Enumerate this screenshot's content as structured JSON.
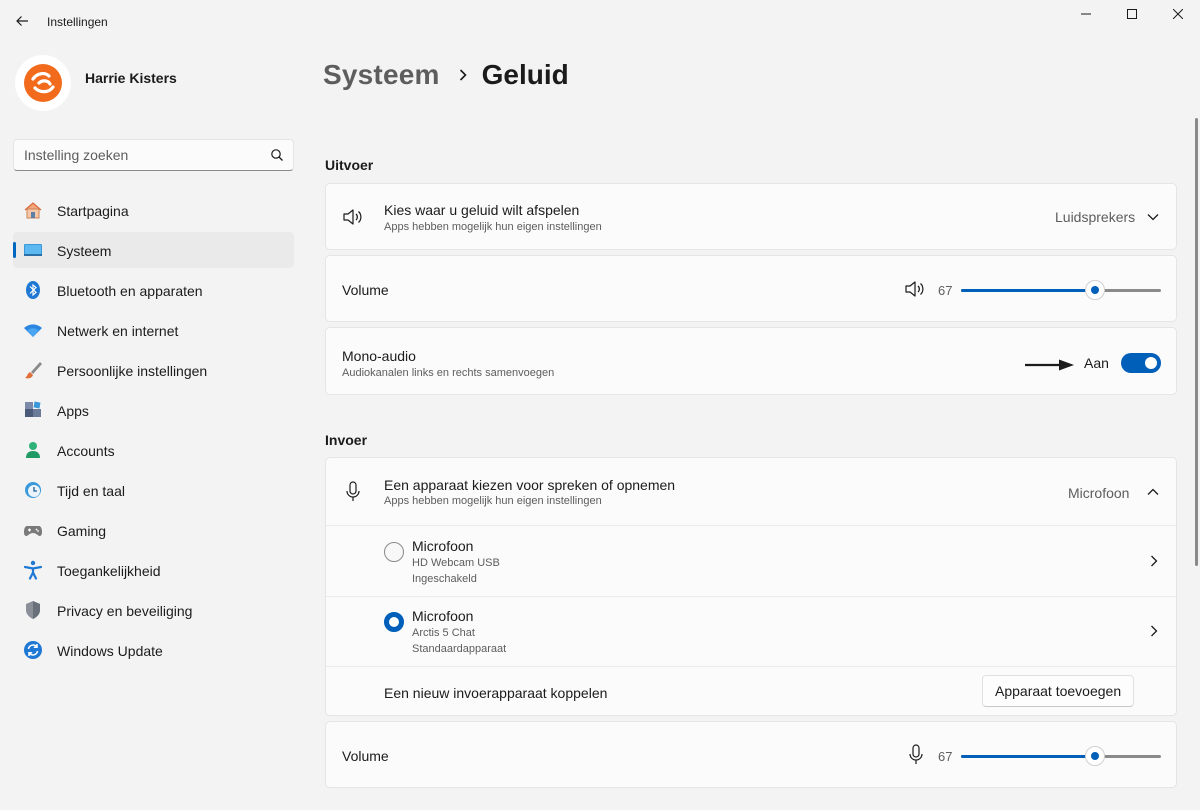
{
  "window": {
    "title": "Instellingen"
  },
  "profile": {
    "name": "Harrie Kisters"
  },
  "search": {
    "placeholder": "Instelling zoeken"
  },
  "sidebar": {
    "items": [
      {
        "label": "Startpagina",
        "icon": "home-icon"
      },
      {
        "label": "Systeem",
        "icon": "monitor-icon",
        "active": true
      },
      {
        "label": "Bluetooth en apparaten",
        "icon": "bluetooth-icon"
      },
      {
        "label": "Netwerk en internet",
        "icon": "wifi-icon"
      },
      {
        "label": "Persoonlijke instellingen",
        "icon": "brush-icon"
      },
      {
        "label": "Apps",
        "icon": "apps-icon"
      },
      {
        "label": "Accounts",
        "icon": "person-icon"
      },
      {
        "label": "Tijd en taal",
        "icon": "clock-globe-icon"
      },
      {
        "label": "Gaming",
        "icon": "gamepad-icon"
      },
      {
        "label": "Toegankelijkheid",
        "icon": "accessibility-icon"
      },
      {
        "label": "Privacy en beveiliging",
        "icon": "shield-icon"
      },
      {
        "label": "Windows Update",
        "icon": "update-icon"
      }
    ]
  },
  "breadcrumb": {
    "parent": "Systeem",
    "current": "Geluid"
  },
  "output": {
    "section_title": "Uitvoer",
    "device": {
      "title": "Kies waar u geluid wilt afspelen",
      "subtitle": "Apps hebben mogelijk hun eigen instellingen",
      "selected": "Luidsprekers"
    },
    "volume": {
      "label": "Volume",
      "value": "67",
      "percent": 67
    },
    "mono": {
      "title": "Mono-audio",
      "subtitle": "Audiokanalen links en rechts samenvoegen",
      "state": "Aan",
      "on": true
    }
  },
  "input": {
    "section_title": "Invoer",
    "device": {
      "title": "Een apparaat kiezen voor spreken of opnemen",
      "subtitle": "Apps hebben mogelijk hun eigen instellingen",
      "selected": "Microfoon"
    },
    "devices": [
      {
        "name": "Microfoon",
        "model": "HD Webcam USB",
        "status": "Ingeschakeld",
        "checked": false
      },
      {
        "name": "Microfoon",
        "model": "Arctis 5 Chat",
        "status": "Standaardapparaat",
        "checked": true
      }
    ],
    "add": {
      "label": "Een nieuw invoerapparaat koppelen",
      "button": "Apparaat toevoegen"
    },
    "volume": {
      "label": "Volume",
      "value": "67",
      "percent": 67
    }
  },
  "colors": {
    "accent": "#005fb8",
    "avatar_orange": "#f26b1d"
  }
}
